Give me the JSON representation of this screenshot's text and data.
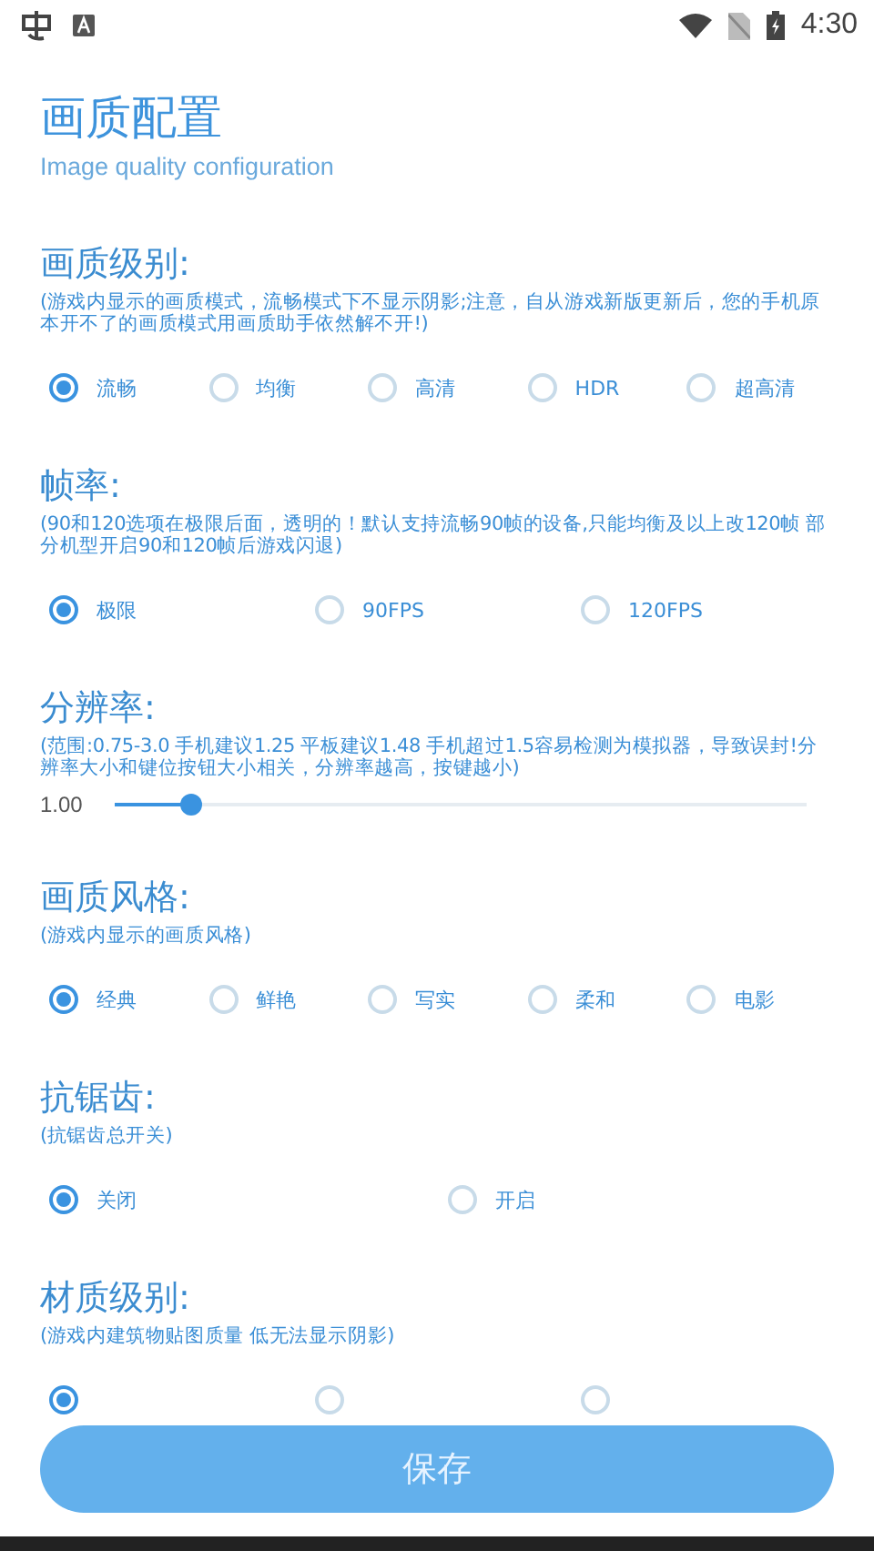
{
  "status_bar": {
    "time": "4:30"
  },
  "page": {
    "title": "画质配置",
    "subtitle": "Image quality configuration"
  },
  "sections": [
    {
      "kind": "radio",
      "heading": "画质级别:",
      "description": "(游戏内显示的画质模式，流畅模式下不显示阴影;注意，自从游戏新版更新后，您的手机原本开不了的画质模式用画质助手依然解不开!)",
      "options": [
        {
          "label": "流畅",
          "selected": true
        },
        {
          "label": "均衡",
          "selected": false
        },
        {
          "label": "高清",
          "selected": false
        },
        {
          "label": "HDR",
          "selected": false
        },
        {
          "label": "超高清",
          "selected": false
        }
      ]
    },
    {
      "kind": "radio",
      "heading": "帧率:",
      "description": "(90和120选项在极限后面，透明的！默认支持流畅90帧的设备,只能均衡及以上改120帧  部分机型开启90和120帧后游戏闪退)",
      "options": [
        {
          "label": "极限",
          "selected": true
        },
        {
          "label": "90FPS",
          "selected": false
        },
        {
          "label": "120FPS",
          "selected": false
        }
      ]
    },
    {
      "kind": "slider",
      "heading": "分辨率:",
      "description": "(范围:0.75-3.0  手机建议1.25 平板建议1.48  手机超过1.5容易检测为模拟器，导致误封!分辨率大小和键位按钮大小相关，分辨率越高，按键越小)",
      "reading": "1.00",
      "level": 0.11
    },
    {
      "kind": "radio",
      "heading": "画质风格:",
      "description": "(游戏内显示的画质风格)",
      "options": [
        {
          "label": "经典",
          "selected": true
        },
        {
          "label": "鲜艳",
          "selected": false
        },
        {
          "label": "写实",
          "selected": false
        },
        {
          "label": "柔和",
          "selected": false
        },
        {
          "label": "电影",
          "selected": false
        }
      ]
    },
    {
      "kind": "radio",
      "heading": "抗锯齿:",
      "description": "(抗锯齿总开关)",
      "options": [
        {
          "label": "关闭",
          "selected": true
        },
        {
          "label": "开启",
          "selected": false
        }
      ]
    },
    {
      "kind": "radio",
      "heading": "材质级别:",
      "description": "(游戏内建筑物贴图质量 低无法显示阴影)",
      "options": [
        {
          "selected": true
        },
        {
          "selected": false
        },
        {
          "selected": false
        }
      ]
    }
  ],
  "save_button": {
    "label": "保存"
  }
}
